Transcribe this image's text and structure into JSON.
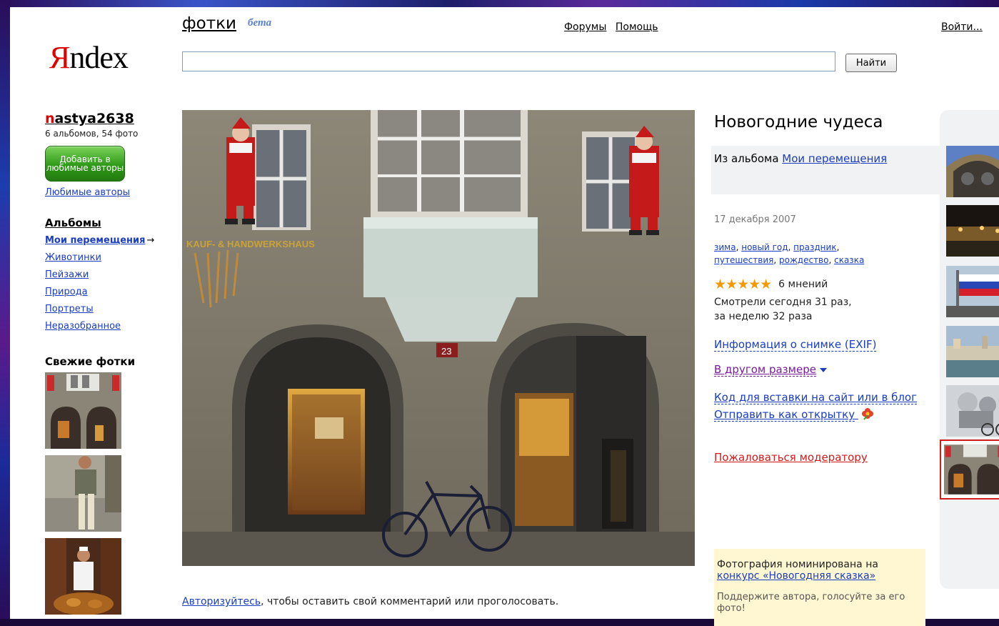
{
  "header": {
    "logo_initial": "Я",
    "logo_rest": "ndex",
    "service_name": "фотки",
    "beta_label": "бета",
    "nav": [
      "Форумы",
      "Помощь"
    ],
    "login": "Войти...",
    "search": {
      "value": "",
      "placeholder": ""
    },
    "search_button": "Найти"
  },
  "author": {
    "username_first": "n",
    "username_rest": "astya2638",
    "stats": "6 альбомов, 54 фото",
    "add_favorite_label": "Добавить в любимые авторы",
    "favorites_link": "Любимые авторы"
  },
  "albums": {
    "title": "Альбомы",
    "current": "Мои перемещения",
    "current_arrow": "→",
    "items": [
      "Животинки",
      "Пейзажи",
      "Природа",
      "Портреты",
      "Неразобранное"
    ]
  },
  "fresh": {
    "title": "Свежие фотки",
    "thumbs": [
      "facade-thumb",
      "person-street-thumb",
      "chef-market-thumb"
    ]
  },
  "photo": {
    "title": "Новогодние чудеса",
    "album_prefix": "Из альбома ",
    "album_link": "Мои перемещения",
    "date": "17 декабря 2007",
    "tags": [
      "зима",
      "новый год",
      "праздник",
      "путешествия",
      "рождество",
      "сказка"
    ],
    "stars": "★★★★★",
    "rating_value": 5,
    "reviews": "6 мнений",
    "views_today": "Смотрели сегодня 31 раз,",
    "views_week": "за неделю 32 раза",
    "exif_link": "Информация о снимке (EXIF)",
    "size_link": "В другом размере",
    "embed_link": "Код для вставки на сайт или в блог",
    "postcard_link": "Отправить как открытку",
    "complain_link": "Пожаловаться модератору",
    "house_number": "23",
    "shop_sign": "KAUF- & HANDWERKSHAUS"
  },
  "contest": {
    "text": "Фотография номинирована на",
    "link": "конкурс «Новогодняя сказка»",
    "support": "Поддержите автора, голосуйте за его фото!"
  },
  "comment_note": {
    "link": "Авторизуйтесь",
    "text": ", чтобы оставить свой комментарий или проголосовать."
  },
  "filmstrip": [
    "arch-clock",
    "night-river",
    "russian-flag",
    "coast-town",
    "statues-bicycle",
    "current-facade"
  ],
  "colors": {
    "link": "#1a3dc1",
    "brand_red": "#e10000",
    "stars": "#f29a00",
    "complain": "#d21c1c"
  }
}
